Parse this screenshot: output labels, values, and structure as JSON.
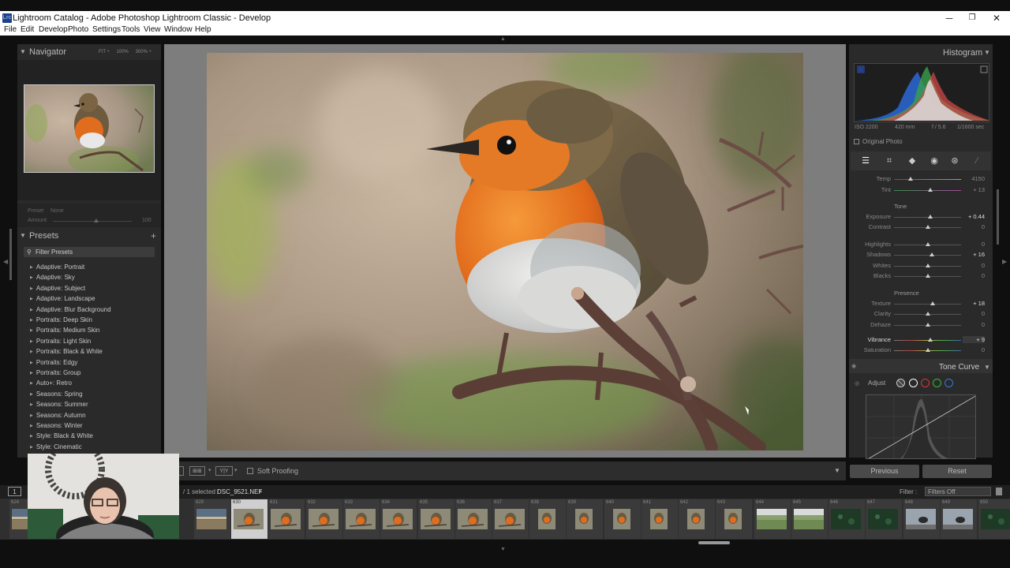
{
  "window": {
    "title": "Lightroom Catalog - Adobe Photoshop Lightroom Classic - Develop",
    "app_icon": "Lrc",
    "minimize": "─",
    "restore": "❐",
    "close": "✕"
  },
  "menu": [
    "File",
    "Edit",
    "Develop",
    "Photo",
    "Settings",
    "Tools",
    "View",
    "Window",
    "Help"
  ],
  "navigator": {
    "title": "Navigator",
    "zoom_options": [
      "FIT ÷",
      "100%",
      "300% ÷"
    ]
  },
  "preset_amount": {
    "preset_label": "Preset",
    "preset_value": "None",
    "amount_label": "Amount",
    "amount_value": "100",
    "amount_level": 0.55
  },
  "presets": {
    "title": "Presets",
    "add": "+",
    "filter_placeholder": "Filter Presets",
    "items": [
      "Adaptive: Portrait",
      "Adaptive: Sky",
      "Adaptive: Subject",
      "Adaptive: Landscape",
      "Adaptive: Blur Background",
      "Portraits: Deep Skin",
      "Portraits: Medium Skin",
      "Portraits: Light Skin",
      "Portraits: Black & White",
      "Portraits: Edgy",
      "Portraits: Group",
      "Auto+: Retro",
      "Seasons: Spring",
      "Seasons: Summer",
      "Seasons: Autumn",
      "Seasons: Winter",
      "Style: Black & White",
      "Style: Cinematic"
    ]
  },
  "toolbar": {
    "soft_proofing": "Soft Proofing",
    "view_square": "1",
    "compare_label": "Y|Y"
  },
  "histogram": {
    "title": "Histogram",
    "iso": "ISO 2200",
    "focal": "420 mm",
    "aperture": "f / 5.6",
    "shutter": "1/1600 sec",
    "original_photo": "Original Photo"
  },
  "basic": {
    "wb_sliders": [
      {
        "label": "Temp",
        "value": "4150",
        "level": 0.25
      },
      {
        "label": "Tint",
        "value": "+ 13",
        "level": 0.54
      }
    ],
    "tone_header": "Tone",
    "tone_sliders": [
      {
        "label": "Exposure",
        "value": "+ 0.44",
        "level": 0.54
      },
      {
        "label": "Contrast",
        "value": "0",
        "level": 0.5
      }
    ],
    "tone_sliders2": [
      {
        "label": "Highlights",
        "value": "0",
        "level": 0.5
      },
      {
        "label": "Shadows",
        "value": "+ 16",
        "level": 0.57
      },
      {
        "label": "Whites",
        "value": "0",
        "level": 0.5
      },
      {
        "label": "Blacks",
        "value": "0",
        "level": 0.5
      }
    ],
    "presence_header": "Presence",
    "presence_sliders": [
      {
        "label": "Texture",
        "value": "+ 18",
        "level": 0.58
      },
      {
        "label": "Clarity",
        "value": "0",
        "level": 0.5
      },
      {
        "label": "Dehaze",
        "value": "0",
        "level": 0.5
      },
      {
        "label": "Vibrance",
        "value": "+ 9",
        "level": 0.54
      },
      {
        "label": "Saturation",
        "value": "0",
        "level": 0.5
      }
    ]
  },
  "tone_curve": {
    "title": "Tone Curve",
    "adjust_label": "Adjust"
  },
  "buttons": {
    "previous": "Previous",
    "reset": "Reset"
  },
  "filmbar": {
    "selection": "/ 1 selected /",
    "filename": "DSC_9521.NEF",
    "filter_label": "Filter :",
    "filter_value": "Filters Off"
  },
  "filmstrip": {
    "frames": [
      {
        "num": "624",
        "kind": "landscape"
      },
      {
        "num": "629",
        "kind": "landscape"
      },
      {
        "num": "630",
        "kind": "robin"
      },
      {
        "num": "631",
        "kind": "robin"
      },
      {
        "num": "632",
        "kind": "robin"
      },
      {
        "num": "633",
        "kind": "robin"
      },
      {
        "num": "634",
        "kind": "robin"
      },
      {
        "num": "635",
        "kind": "robin"
      },
      {
        "num": "636",
        "kind": "robin"
      },
      {
        "num": "637",
        "kind": "robin"
      },
      {
        "num": "638",
        "kind": "robin-portrait"
      },
      {
        "num": "639",
        "kind": "robin-portrait"
      },
      {
        "num": "640",
        "kind": "robin-portrait"
      },
      {
        "num": "641",
        "kind": "robin-portrait"
      },
      {
        "num": "642",
        "kind": "robin-portrait"
      },
      {
        "num": "643",
        "kind": "robin-portrait"
      },
      {
        "num": "644",
        "kind": "field"
      },
      {
        "num": "645",
        "kind": "field"
      },
      {
        "num": "646",
        "kind": "dark-green"
      },
      {
        "num": "647",
        "kind": "dark-green"
      },
      {
        "num": "648",
        "kind": "bird-grey"
      },
      {
        "num": "649",
        "kind": "bird-grey"
      },
      {
        "num": "650",
        "kind": "dark-green"
      }
    ]
  }
}
